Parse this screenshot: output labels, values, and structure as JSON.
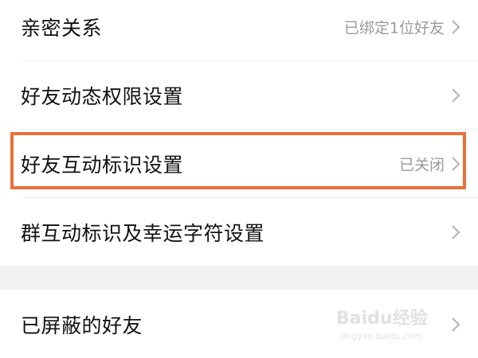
{
  "settings": {
    "rows": [
      {
        "label": "亲密关系",
        "value": "已绑定1位好友"
      },
      {
        "label": "好友动态权限设置",
        "value": ""
      },
      {
        "label": "好友互动标识设置",
        "value": "已关闭"
      },
      {
        "label": "群互动标识及幸运字符设置",
        "value": ""
      },
      {
        "label": "已屏蔽的好友",
        "value": ""
      }
    ]
  },
  "watermark": {
    "brand": "Baidu经验",
    "url": "jingyan.baidu.com"
  },
  "colors": {
    "highlight_border": "#e8703a",
    "value_text": "#9b9b9b",
    "label_text": "#111111",
    "section_gap": "#f2f2f2"
  }
}
